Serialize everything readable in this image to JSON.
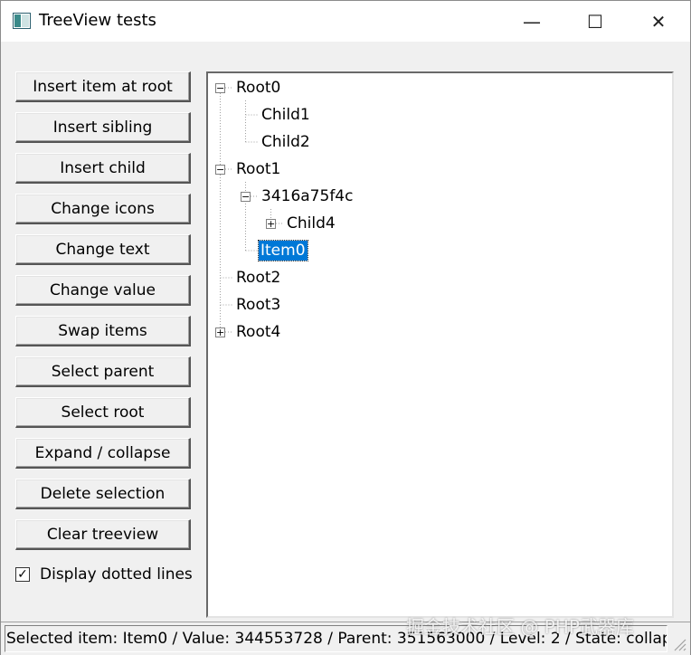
{
  "window": {
    "title": "TreeView tests",
    "minimize_glyph": "—",
    "maximize_glyph": "☐",
    "close_glyph": "✕"
  },
  "buttons": [
    {
      "label": "Insert item at root"
    },
    {
      "label": "Insert sibling"
    },
    {
      "label": "Insert child"
    },
    {
      "label": "Change icons"
    },
    {
      "label": "Change text"
    },
    {
      "label": "Change value"
    },
    {
      "label": "Swap items"
    },
    {
      "label": "Select parent"
    },
    {
      "label": "Select root"
    },
    {
      "label": "Expand / collapse"
    },
    {
      "label": "Delete selection"
    },
    {
      "label": "Clear treeview"
    }
  ],
  "dotted_lines": {
    "label": "Display dotted lines",
    "checked": true,
    "check_glyph": "✓"
  },
  "tree": {
    "expander_collapse_glyph": "−",
    "expander_expand_glyph": "+",
    "nodes": [
      {
        "label": "Root0",
        "level": 0,
        "expander": "minus"
      },
      {
        "label": "Child1",
        "level": 1,
        "expander": "none"
      },
      {
        "label": "Child2",
        "level": 1,
        "expander": "none"
      },
      {
        "label": "Root1",
        "level": 0,
        "expander": "minus"
      },
      {
        "label": "3416a75f4c",
        "level": 1,
        "expander": "minus"
      },
      {
        "label": "Child4",
        "level": 2,
        "expander": "plus"
      },
      {
        "label": "Item0",
        "level": 1,
        "expander": "none",
        "selected": true
      },
      {
        "label": "Root2",
        "level": 0,
        "expander": "none"
      },
      {
        "label": "Root3",
        "level": 0,
        "expander": "none"
      },
      {
        "label": "Root4",
        "level": 0,
        "expander": "plus"
      }
    ]
  },
  "status": {
    "text": "Selected item: Item0 / Value: 344553728 / Parent: 351563000 / Level: 2 / State: collap"
  },
  "watermark": "掘金技术社区 @ PHP武器库",
  "colors": {
    "selection": "#0078d7",
    "background": "#f0f0f0"
  }
}
